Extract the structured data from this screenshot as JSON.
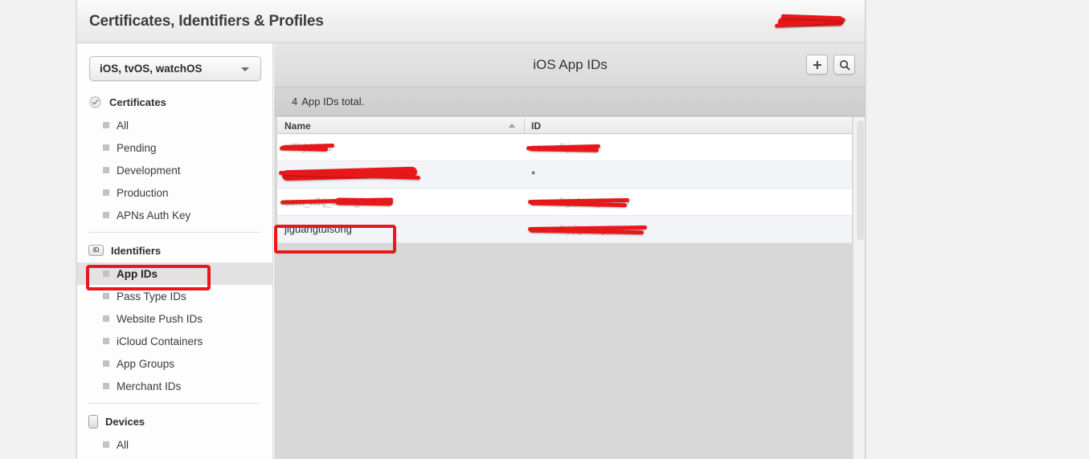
{
  "window": {
    "title": "Certificates, Identifiers & Profiles",
    "account_label": ""
  },
  "sidebar": {
    "platform_select": {
      "value": "iOS, tvOS, watchOS",
      "caret_icon": "chevron-down-icon"
    },
    "groups": [
      {
        "label": "Certificates",
        "icon": "seal-check-icon",
        "items": [
          {
            "label": "All",
            "selected": false
          },
          {
            "label": "Pending",
            "selected": false
          },
          {
            "label": "Development",
            "selected": false
          },
          {
            "label": "Production",
            "selected": false
          },
          {
            "label": "APNs Auth Key",
            "selected": false
          }
        ]
      },
      {
        "label": "Identifiers",
        "icon": "id-badge-icon",
        "items": [
          {
            "label": "App IDs",
            "selected": true
          },
          {
            "label": "Pass Type IDs",
            "selected": false
          },
          {
            "label": "Website Push IDs",
            "selected": false
          },
          {
            "label": "iCloud Containers",
            "selected": false
          },
          {
            "label": "App Groups",
            "selected": false
          },
          {
            "label": "Merchant IDs",
            "selected": false
          }
        ]
      },
      {
        "label": "Devices",
        "icon": "device-phone-icon",
        "items": [
          {
            "label": "All",
            "selected": false
          }
        ]
      }
    ]
  },
  "content": {
    "header": {
      "title": "iOS App IDs",
      "add_button_icon": "plus-icon",
      "search_button_icon": "search-icon"
    },
    "total_bar": {
      "count": "4",
      "text": "App IDs total."
    },
    "table": {
      "columns": [
        {
          "key": "name",
          "label": "Name",
          "sort": "ascending"
        },
        {
          "key": "id",
          "label": "ID",
          "sort": "none"
        }
      ],
      "rows": [
        {
          "name": "XFkjXMzc",
          "id": "com.xfkj.xmzc",
          "name_redacted": true,
          "id_redacted": true,
          "highlighted": false
        },
        {
          "name": "",
          "id": "*",
          "name_redacted": true,
          "id_redacted": false,
          "highlighted": false
        },
        {
          "name": "com_xfkj_chongkabao",
          "id": "com.xfkj.chongkabao",
          "name_redacted": true,
          "id_redacted": true,
          "highlighted": false
        },
        {
          "name": "jiguangtuisong",
          "id": "com.xfkj.jiguangtuisong",
          "name_redacted": false,
          "id_redacted": true,
          "highlighted": true
        }
      ]
    }
  },
  "annotations": {
    "accent_color": "#e8171a",
    "boxes": [
      {
        "name": "app-ids-annotation",
        "target": "App IDs"
      },
      {
        "name": "jiguangtuisong-annotation",
        "target": "jiguangtuisong"
      }
    ]
  }
}
